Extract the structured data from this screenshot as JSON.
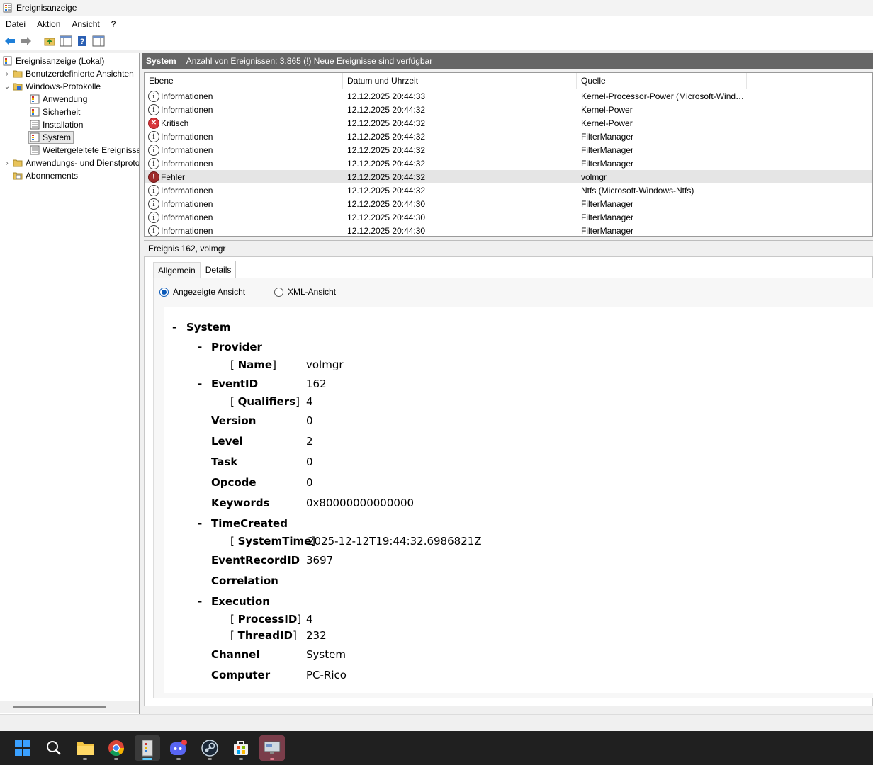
{
  "window": {
    "title": "Ereignisanzeige"
  },
  "menu": [
    "Datei",
    "Aktion",
    "Ansicht",
    "?"
  ],
  "toolbar": {
    "icons": [
      "back-arrow-icon",
      "forward-arrow-icon",
      "folder-up-icon",
      "show-hide-tree-icon",
      "help-icon",
      "action-pane-icon"
    ]
  },
  "tree": {
    "root": "Ereignisanzeige (Lokal)",
    "custom_views": "Benutzerdefinierte Ansichten",
    "windows_logs": "Windows-Protokolle",
    "logs": [
      "Anwendung",
      "Sicherheit",
      "Installation",
      "System",
      "Weitergeleitete Ereignisse"
    ],
    "app_logs": "Anwendungs- und Dienstprotokolle",
    "subscriptions": "Abonnements"
  },
  "list": {
    "log_name": "System",
    "summary": "Anzahl von Ereignissen: 3.865 (!) Neue Ereignisse sind verfügbar",
    "columns": [
      "Ebene",
      "Datum und Uhrzeit",
      "Quelle"
    ],
    "rows": [
      {
        "level": "Informationen",
        "kind": "info",
        "date": "12.12.2025 20:44:33",
        "source": "Kernel-Processor-Power (Microsoft-Wind…"
      },
      {
        "level": "Informationen",
        "kind": "info",
        "date": "12.12.2025 20:44:32",
        "source": "Kernel-Power"
      },
      {
        "level": "Kritisch",
        "kind": "crit",
        "date": "12.12.2025 20:44:32",
        "source": "Kernel-Power"
      },
      {
        "level": "Informationen",
        "kind": "info",
        "date": "12.12.2025 20:44:32",
        "source": "FilterManager"
      },
      {
        "level": "Informationen",
        "kind": "info",
        "date": "12.12.2025 20:44:32",
        "source": "FilterManager"
      },
      {
        "level": "Informationen",
        "kind": "info",
        "date": "12.12.2025 20:44:32",
        "source": "FilterManager"
      },
      {
        "level": "Fehler",
        "kind": "err",
        "date": "12.12.2025 20:44:32",
        "source": "volmgr"
      },
      {
        "level": "Informationen",
        "kind": "info",
        "date": "12.12.2025 20:44:32",
        "source": "Ntfs (Microsoft-Windows-Ntfs)"
      },
      {
        "level": "Informationen",
        "kind": "info",
        "date": "12.12.2025 20:44:30",
        "source": "FilterManager"
      },
      {
        "level": "Informationen",
        "kind": "info",
        "date": "12.12.2025 20:44:30",
        "source": "FilterManager"
      },
      {
        "level": "Informationen",
        "kind": "info",
        "date": "12.12.2025 20:44:30",
        "source": "FilterManager"
      }
    ]
  },
  "detail": {
    "title": "Ereignis 162, volmgr",
    "tabs": [
      "Allgemein",
      "Details"
    ],
    "radio_friendly": "Angezeigte Ansicht",
    "radio_xml": "XML-Ansicht",
    "entries": [
      {
        "dash": true,
        "key": "System",
        "val": ""
      },
      {
        "dash": true,
        "key": "Provider",
        "val": ""
      },
      {
        "attr": true,
        "key": "Name",
        "val": "volmgr"
      },
      {
        "dash": true,
        "key": "EventID",
        "val": "162"
      },
      {
        "attr": true,
        "key": "Qualifiers",
        "val": "4"
      },
      {
        "key": "Version",
        "val": "0"
      },
      {
        "key": "Level",
        "val": "2"
      },
      {
        "key": "Task",
        "val": "0"
      },
      {
        "key": "Opcode",
        "val": "0"
      },
      {
        "key": "Keywords",
        "val": "0x80000000000000"
      },
      {
        "dash": true,
        "key": "TimeCreated",
        "val": ""
      },
      {
        "attr": true,
        "key": "SystemTime",
        "val": "2025-12-12T19:44:32.6986821Z"
      },
      {
        "key": "EventRecordID",
        "val": "3697"
      },
      {
        "key": "Correlation",
        "val": ""
      },
      {
        "dash": true,
        "key": "Execution",
        "val": ""
      },
      {
        "attr": true,
        "key": "ProcessID",
        "val": "4"
      },
      {
        "attr": true,
        "key": "ThreadID",
        "val": "232"
      },
      {
        "key": "Channel",
        "val": "System"
      },
      {
        "key": "Computer",
        "val": "PC-Rico"
      }
    ]
  },
  "taskbar": {
    "apps": [
      "start-icon",
      "search-icon",
      "file-explorer-icon",
      "chrome-icon",
      "event-viewer-icon",
      "discord-icon",
      "steam-icon",
      "store-icon",
      "remote-desktop-icon"
    ]
  }
}
